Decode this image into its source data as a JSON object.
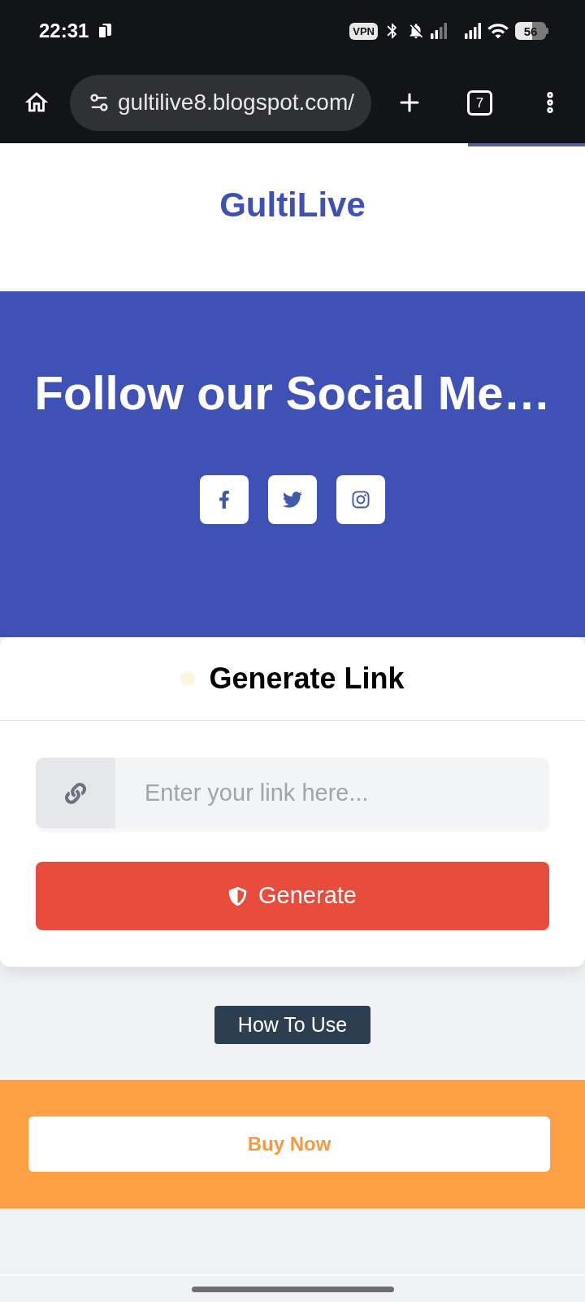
{
  "status_bar": {
    "time": "22:31",
    "vpn": "VPN",
    "battery": "56"
  },
  "browser": {
    "url": "gultilive8.blogspot.com/",
    "tab_count": "7",
    "load_progress": {
      "level": 0.8
    }
  },
  "header": {
    "title": "GultiLive"
  },
  "social": {
    "heading": "Follow our Social Me…",
    "links": [
      {
        "kind": "facebook"
      },
      {
        "kind": "twitter"
      },
      {
        "kind": "instagram"
      }
    ]
  },
  "generator": {
    "title": "Generate Link",
    "input": {
      "placeholder": "Enter your link here..."
    },
    "button": "Generate"
  },
  "how_to_use": {
    "button": "How To Use"
  },
  "buy": {
    "button": "Buy Now"
  }
}
